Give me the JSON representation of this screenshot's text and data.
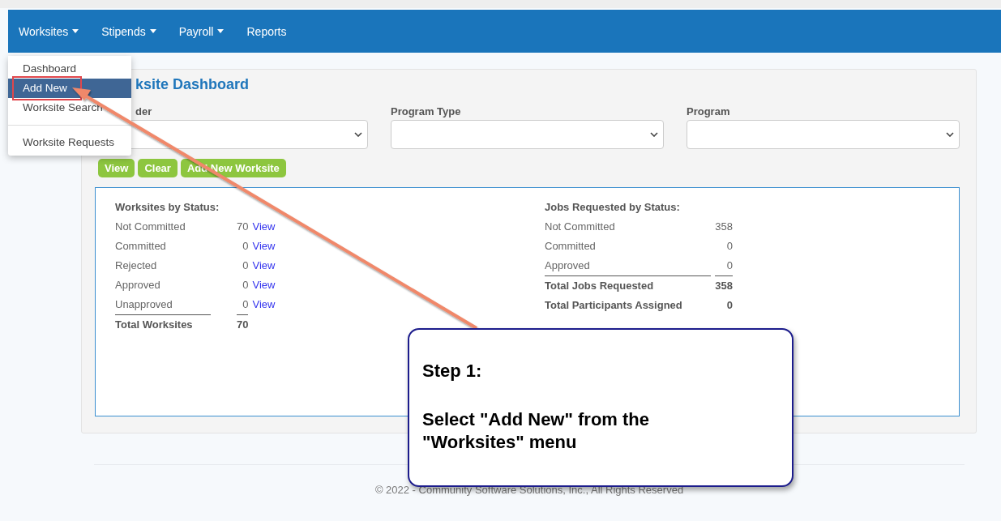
{
  "nav": {
    "items": [
      {
        "label": "Worksites",
        "caret": true,
        "menu": {
          "items": [
            {
              "kind": "item",
              "label": "Dashboard",
              "selected": false,
              "highlighted": false
            },
            {
              "kind": "item",
              "label": "Add New",
              "selected": true,
              "highlighted": true
            },
            {
              "kind": "item",
              "label": "Worksite Search",
              "selected": false,
              "highlighted": false
            },
            {
              "kind": "divider"
            },
            {
              "kind": "item",
              "label": "Worksite Requests",
              "selected": false,
              "highlighted": false
            }
          ]
        }
      },
      {
        "label": "Stipends",
        "caret": true
      },
      {
        "label": "Payroll",
        "caret": true
      },
      {
        "label": "Reports",
        "caret": false
      }
    ]
  },
  "panel": {
    "title": "ksite Dashboard",
    "filters": [
      {
        "label": "der"
      },
      {
        "label": "Program Type"
      },
      {
        "label": "Program"
      }
    ],
    "buttons": [
      "View",
      "Clear",
      "Add New Worksite"
    ],
    "worksites": {
      "title": "Worksites by Status:",
      "rows": [
        {
          "label": "Not Committed",
          "value": "70",
          "link": "View"
        },
        {
          "label": "Committed",
          "value": "0",
          "link": "View"
        },
        {
          "label": "Rejected",
          "value": "0",
          "link": "View"
        },
        {
          "label": "Approved",
          "value": "0",
          "link": "View"
        },
        {
          "label": "Unapproved",
          "value": "0",
          "link": "View"
        }
      ],
      "total": {
        "label": "Total Worksites",
        "value": "70"
      }
    },
    "jobs": {
      "title": "Jobs Requested by Status:",
      "rows": [
        {
          "label": "Not Committed",
          "value": "358"
        },
        {
          "label": "Committed",
          "value": "0"
        },
        {
          "label": "Approved",
          "value": "0"
        }
      ],
      "totals": [
        {
          "label": "Total Jobs Requested",
          "value": "358"
        },
        {
          "label": "Total Participants Assigned",
          "value": "0"
        }
      ]
    }
  },
  "footer": {
    "text": "© 2022 - Community Software Solutions, Inc., All Rights Reserved"
  },
  "callout": {
    "title": "Step 1:",
    "text": "Select \"Add New\" from the \"Worksites\" menu"
  }
}
